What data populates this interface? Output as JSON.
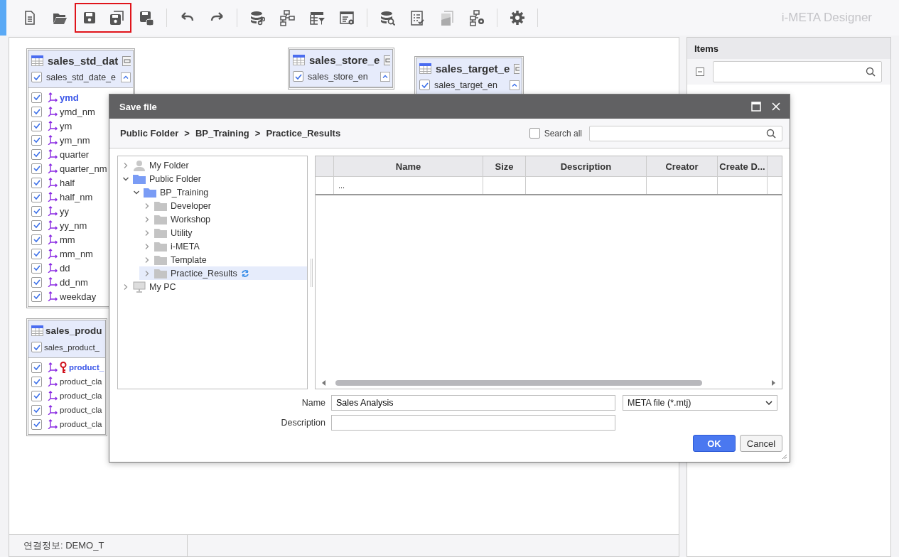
{
  "toolbar": {
    "groups": [
      {
        "items": [
          {
            "kind": "new-file",
            "highlighted": false,
            "disabled": false
          },
          {
            "kind": "open-folder",
            "highlighted": false,
            "disabled": false
          },
          {
            "kind": "save",
            "highlighted": true,
            "disabled": false
          },
          {
            "kind": "save-as",
            "highlighted": true,
            "disabled": false
          },
          {
            "kind": "save-db",
            "highlighted": false,
            "disabled": false
          }
        ]
      },
      {
        "items": [
          {
            "kind": "undo",
            "highlighted": false,
            "disabled": false
          },
          {
            "kind": "redo",
            "highlighted": false,
            "disabled": false
          }
        ]
      },
      {
        "items": [
          {
            "kind": "db-link",
            "highlighted": false,
            "disabled": false
          },
          {
            "kind": "tree",
            "highlighted": false,
            "disabled": false
          },
          {
            "kind": "table-filter",
            "highlighted": false,
            "disabled": false
          },
          {
            "kind": "window-gear",
            "highlighted": false,
            "disabled": false
          }
        ]
      },
      {
        "items": [
          {
            "kind": "db-search",
            "highlighted": false,
            "disabled": false
          },
          {
            "kind": "checklist",
            "highlighted": false,
            "disabled": false
          },
          {
            "kind": "document",
            "highlighted": false,
            "disabled": true
          },
          {
            "kind": "tree-gear",
            "highlighted": false,
            "disabled": false
          }
        ]
      },
      {
        "items": [
          {
            "kind": "settings",
            "highlighted": false,
            "disabled": false
          }
        ]
      }
    ],
    "brand": "i-META Designer"
  },
  "canvas": {
    "entities": [
      {
        "title": "sales_std_dat",
        "subtitle": "sales_std_date_e",
        "checked": true,
        "fields": [
          {
            "name": "ymd",
            "checked": true,
            "key": false,
            "emphasized": true
          },
          {
            "name": "ymd_nm",
            "checked": true,
            "key": false,
            "emphasized": false
          },
          {
            "name": "ym",
            "checked": true,
            "key": false,
            "emphasized": false
          },
          {
            "name": "ym_nm",
            "checked": true,
            "key": false,
            "emphasized": false
          },
          {
            "name": "quarter",
            "checked": true,
            "key": false,
            "emphasized": false
          },
          {
            "name": "quarter_nm",
            "checked": true,
            "key": false,
            "emphasized": false
          },
          {
            "name": "half",
            "checked": true,
            "key": false,
            "emphasized": false
          },
          {
            "name": "half_nm",
            "checked": true,
            "key": false,
            "emphasized": false
          },
          {
            "name": "yy",
            "checked": true,
            "key": false,
            "emphasized": false
          },
          {
            "name": "yy_nm",
            "checked": true,
            "key": false,
            "emphasized": false
          },
          {
            "name": "mm",
            "checked": true,
            "key": false,
            "emphasized": false
          },
          {
            "name": "mm_nm",
            "checked": true,
            "key": false,
            "emphasized": false
          },
          {
            "name": "dd",
            "checked": true,
            "key": false,
            "emphasized": false
          },
          {
            "name": "dd_nm",
            "checked": true,
            "key": false,
            "emphasized": false
          },
          {
            "name": "weekday",
            "checked": true,
            "key": false,
            "emphasized": false
          }
        ]
      },
      {
        "title": "sales_store_e",
        "subtitle": "sales_store_en",
        "checked": true
      },
      {
        "title": "sales_target_e",
        "subtitle": "sales_target_en",
        "checked": true
      },
      {
        "title": "sales_produ",
        "subtitle": "sales_product_",
        "checked": true,
        "fields": [
          {
            "name": "product_",
            "checked": true,
            "key": true,
            "emphasized": true
          },
          {
            "name": "product_cla",
            "checked": true,
            "key": false,
            "emphasized": false
          },
          {
            "name": "product_cla",
            "checked": true,
            "key": false,
            "emphasized": false
          },
          {
            "name": "product_cla",
            "checked": true,
            "key": false,
            "emphasized": false
          },
          {
            "name": "product_cla",
            "checked": true,
            "key": false,
            "emphasized": false
          }
        ]
      }
    ]
  },
  "status_bar": {
    "connection": "연결정보: DEMO_T"
  },
  "items_panel": {
    "title": "Items"
  },
  "dialog": {
    "title": "Save file",
    "breadcrumb": [
      "Public Folder",
      "BP_Training",
      "Practice_Results"
    ],
    "breadcrumb_separator": ">",
    "search_all": {
      "label": "Search all",
      "checked": false
    },
    "tree": [
      {
        "label": "My Folder",
        "kind": "user",
        "expanded": false,
        "selected": false
      },
      {
        "label": "Public Folder",
        "kind": "folder",
        "expanded": true,
        "selected": false,
        "children": [
          {
            "label": "BP_Training",
            "kind": "folder",
            "expanded": true,
            "selected": false,
            "children": [
              {
                "label": "Developer",
                "kind": "folder",
                "expanded": false,
                "selected": false
              },
              {
                "label": "Workshop",
                "kind": "folder",
                "expanded": false,
                "selected": false
              },
              {
                "label": "Utility",
                "kind": "folder",
                "expanded": false,
                "selected": false
              },
              {
                "label": "i-META",
                "kind": "folder",
                "expanded": false,
                "selected": false
              },
              {
                "label": "Template",
                "kind": "folder",
                "expanded": false,
                "selected": false
              },
              {
                "label": "Practice_Results",
                "kind": "folder",
                "expanded": false,
                "selected": true
              }
            ]
          }
        ]
      },
      {
        "label": "My PC",
        "kind": "pc",
        "expanded": false,
        "selected": false
      }
    ],
    "table": {
      "columns": [
        "Name",
        "Size",
        "Description",
        "Creator",
        "Create D..."
      ],
      "rows": [
        [
          "...",
          "",
          "",
          "",
          ""
        ]
      ]
    },
    "name_label": "Name",
    "name_value": "Sales Analysis",
    "file_type": "META file (*.mtj)",
    "description_label": "Description",
    "buttons": [
      {
        "label": "OK",
        "kind": "primary"
      },
      {
        "label": "Cancel",
        "kind": "secondary"
      }
    ]
  }
}
